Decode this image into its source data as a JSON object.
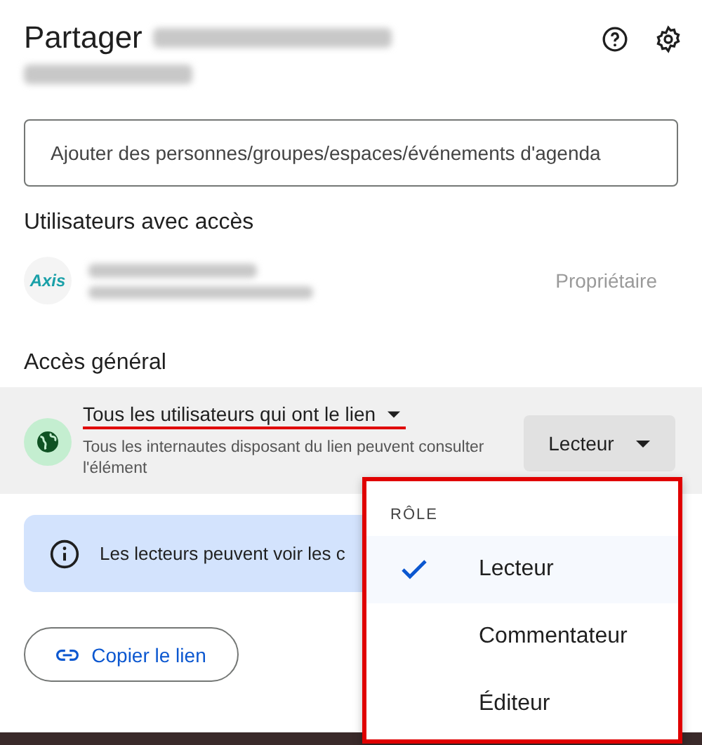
{
  "title": "Partager",
  "search": {
    "placeholder": "Ajouter des personnes/groupes/espaces/événements d'agenda"
  },
  "users_section": {
    "heading": "Utilisateurs avec accès",
    "users": [
      {
        "logo_text": "Axis",
        "role": "Propriétaire"
      }
    ]
  },
  "general_access": {
    "heading": "Accès général",
    "scope": "Tous les utilisateurs qui ont le lien",
    "description": "Tous les internautes disposant du lien peuvent consulter l'élément",
    "role_button": "Lecteur"
  },
  "info_banner": {
    "text": "Les lecteurs peuvent voir les c"
  },
  "copy_link_button": "Copier le lien",
  "role_menu": {
    "heading": "RÔLE",
    "items": [
      {
        "label": "Lecteur",
        "selected": true
      },
      {
        "label": "Commentateur",
        "selected": false
      },
      {
        "label": "Éditeur",
        "selected": false
      }
    ]
  }
}
